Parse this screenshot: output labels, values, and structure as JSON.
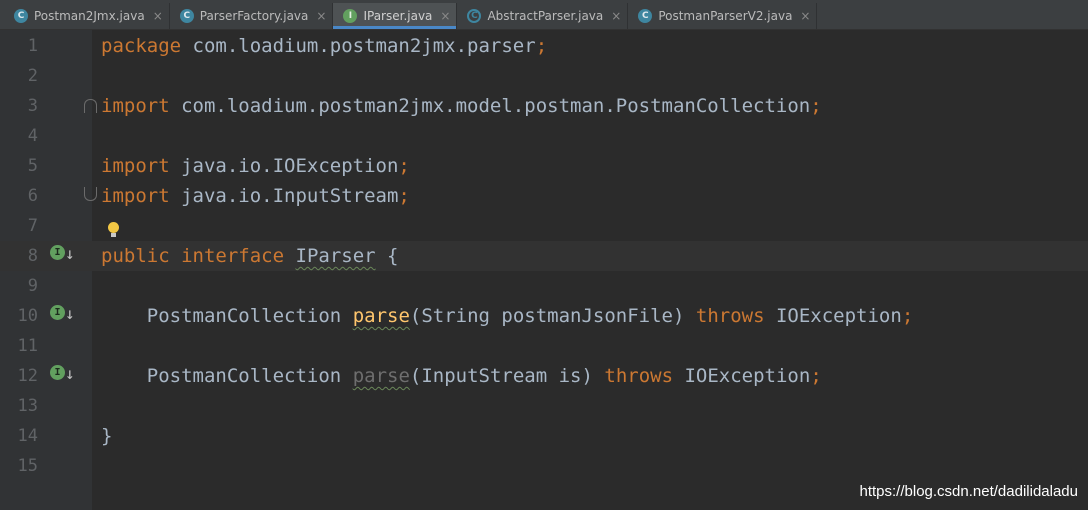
{
  "tabs": [
    {
      "label": "Postman2Jmx.java",
      "type": "class",
      "active": false
    },
    {
      "label": "ParserFactory.java",
      "type": "class",
      "active": false
    },
    {
      "label": "IParser.java",
      "type": "interface",
      "active": true
    },
    {
      "label": "AbstractParser.java",
      "type": "abstract",
      "active": false
    },
    {
      "label": "PostmanParserV2.java",
      "type": "class",
      "active": false
    }
  ],
  "tab_close_glyph": "×",
  "type_badges": {
    "class": "C",
    "interface": "I",
    "abstract": "C"
  },
  "line_numbers": [
    "1",
    "2",
    "3",
    "4",
    "5",
    "6",
    "7",
    "8",
    "9",
    "10",
    "11",
    "12",
    "13",
    "14",
    "15"
  ],
  "code": {
    "l1_kw": "package",
    "l1_pkg": " com.loadium.postman2jmx.parser",
    "l3_kw": "import",
    "l3_path": " com.loadium.postman2jmx.model.postman.PostmanCollection",
    "l5_kw": "import",
    "l5_path": " java.io.IOException",
    "l6_kw": "import",
    "l6_path": " java.io.InputStream",
    "l8_public": "public",
    "l8_interface": "interface",
    "l8_name": "IParser",
    "l8_brace": "{",
    "l10_type": "PostmanCollection",
    "l10_method": "parse",
    "l10_params": "(String postmanJsonFile)",
    "l10_throws": "throws",
    "l10_exc": "IOException",
    "l12_type": "PostmanCollection",
    "l12_method": "parse",
    "l12_params": "(InputStream is)",
    "l12_throws": "throws",
    "l12_exc": "IOException",
    "l14_brace": "}",
    "semicolon": ";"
  },
  "implemented_badge": "I",
  "implemented_arrow": "↓",
  "watermark": "https://blog.csdn.net/dadilidaladu"
}
